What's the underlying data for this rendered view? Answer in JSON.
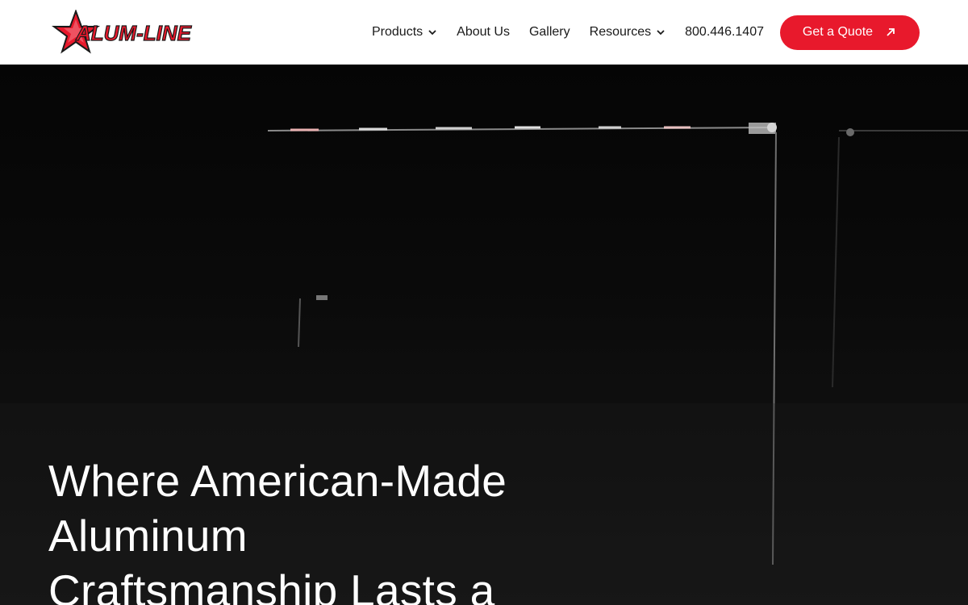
{
  "brand": {
    "name": "ALUM-LINE",
    "logo_icon": "star-logo-icon",
    "accent_color": "#e8192c"
  },
  "nav": {
    "items": [
      {
        "label": "Products",
        "has_dropdown": true
      },
      {
        "label": "About Us",
        "has_dropdown": false
      },
      {
        "label": "Gallery",
        "has_dropdown": false
      },
      {
        "label": "Resources",
        "has_dropdown": true
      },
      {
        "label": "800.446.1407",
        "has_dropdown": false
      }
    ],
    "cta_label": "Get a Quote",
    "cta_icon": "arrow-up-right-icon"
  },
  "hero": {
    "title": "Where American-Made Aluminum Craftsmanship Lasts a"
  }
}
